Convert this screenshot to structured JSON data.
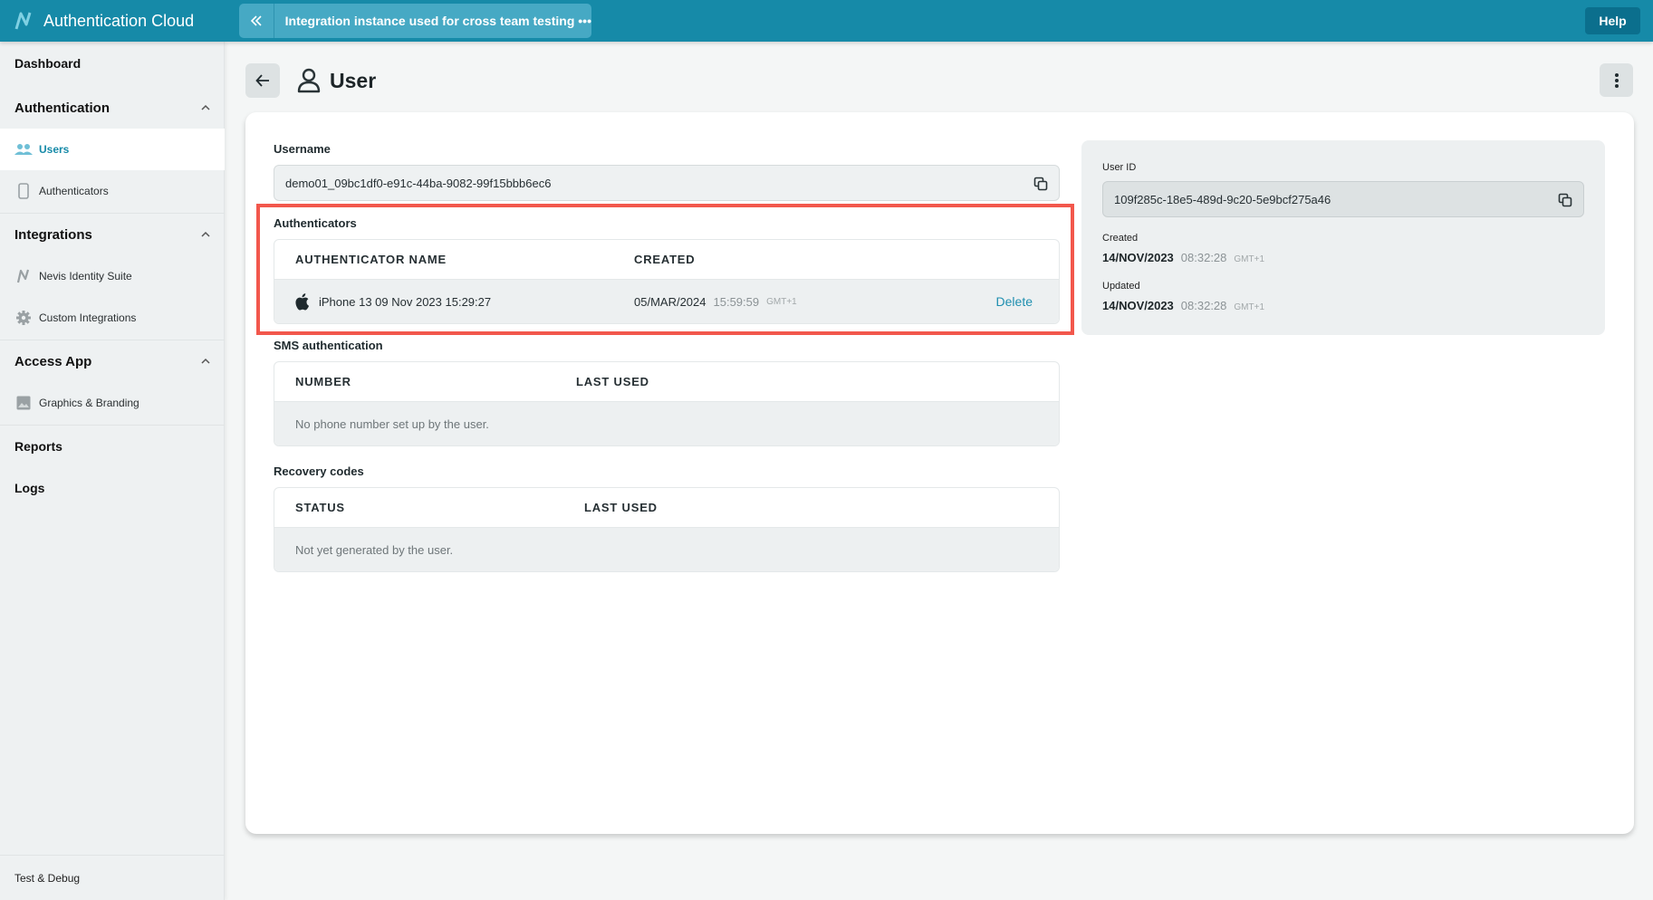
{
  "app": {
    "title": "Authentication Cloud",
    "instance_title": "Integration instance used for cross team testing •••",
    "help_label": "Help",
    "brand_color": "#168aa8"
  },
  "sidebar": {
    "dashboard": "Dashboard",
    "groups": [
      {
        "label": "Authentication",
        "expanded": true,
        "items": [
          {
            "label": "Users",
            "icon": "users-icon",
            "active": true
          },
          {
            "label": "Authenticators",
            "icon": "phone-icon",
            "active": false
          }
        ]
      },
      {
        "label": "Integrations",
        "expanded": true,
        "items": [
          {
            "label": "Nevis Identity Suite",
            "icon": "nevis-logo-icon",
            "active": false
          },
          {
            "label": "Custom Integrations",
            "icon": "gear-icon",
            "active": false
          }
        ]
      },
      {
        "label": "Access App",
        "expanded": true,
        "items": [
          {
            "label": "Graphics & Branding",
            "icon": "image-icon",
            "active": false
          }
        ]
      }
    ],
    "reports": "Reports",
    "logs": "Logs",
    "footer": "Test & Debug"
  },
  "page": {
    "title": "User",
    "username": {
      "label": "Username",
      "value": "demo01_09bc1df0-e91c-44ba-9082-99f15bbb6ec6"
    },
    "authenticators": {
      "title": "Authenticators",
      "columns": [
        "AUTHENTICATOR NAME",
        "CREATED"
      ],
      "rows": [
        {
          "platform_icon": "apple-icon",
          "name": "iPhone 13 09 Nov 2023 15:29:27",
          "created_date": "05/MAR/2024",
          "created_time": "15:59:59",
          "created_tz": "GMT+1",
          "action": "Delete"
        }
      ]
    },
    "sms": {
      "title": "SMS authentication",
      "columns": [
        "NUMBER",
        "LAST USED"
      ],
      "empty": "No phone number set up by the user."
    },
    "recovery": {
      "title": "Recovery codes",
      "columns": [
        "STATUS",
        "LAST USED"
      ],
      "empty": "Not yet generated by the user."
    },
    "info": {
      "user_id_label": "User ID",
      "user_id": "109f285c-18e5-489d-9c20-5e9bcf275a46",
      "created_label": "Created",
      "created_date": "14/NOV/2023",
      "created_time": "08:32:28",
      "created_tz": "GMT+1",
      "updated_label": "Updated",
      "updated_date": "14/NOV/2023",
      "updated_time": "08:32:28",
      "updated_tz": "GMT+1"
    },
    "highlight_color": "#f2574c"
  }
}
